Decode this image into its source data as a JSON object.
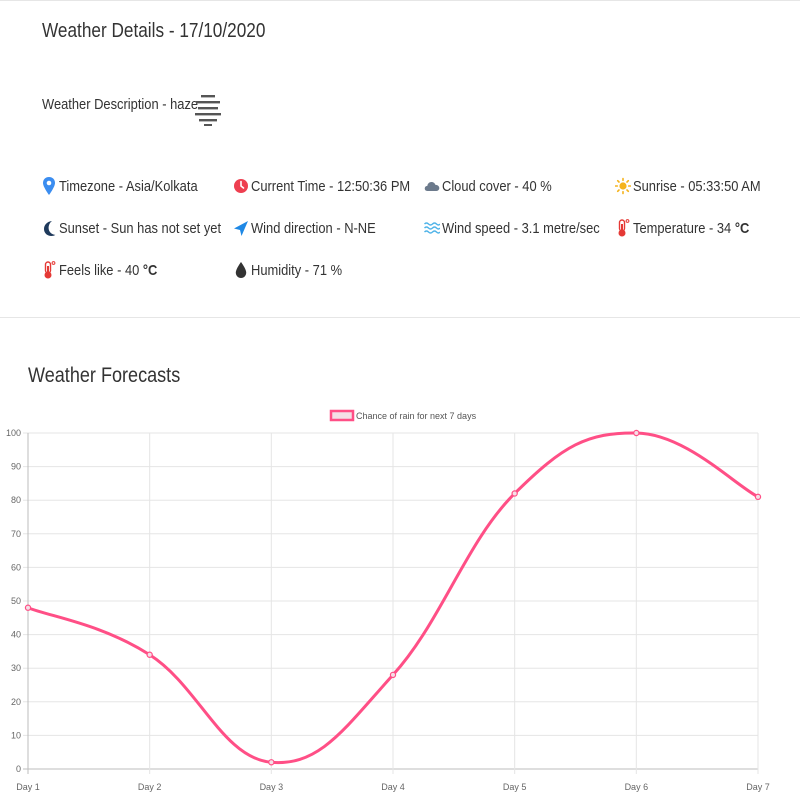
{
  "details": {
    "title": "Weather Details - 17/10/2020",
    "description_label": "Weather Description - haze",
    "description_icon": "haze-icon",
    "items": [
      {
        "name": "timezone",
        "icon": "map-pin-icon",
        "color": "#3b8df0",
        "text": "Timezone - Asia/Kolkata"
      },
      {
        "name": "current-time",
        "icon": "clock-icon",
        "color": "#ee3f50",
        "text": "Current Time - 12:50:36 PM"
      },
      {
        "name": "cloud-cover",
        "icon": "cloud-icon",
        "color": "#6c7a8c",
        "text": "Cloud cover - 40 %"
      },
      {
        "name": "sunrise",
        "icon": "sun-icon",
        "color": "#f5b31c",
        "text": "Sunrise - 05:33:50 AM"
      },
      {
        "name": "sunset",
        "icon": "moon-icon",
        "color": "#1f3a5c",
        "text": "Sunset - Sun has not set yet"
      },
      {
        "name": "wind-direction",
        "icon": "navigation-arrow-icon",
        "color": "#1e88e5",
        "text": "Wind direction - N-NE"
      },
      {
        "name": "wind-speed",
        "icon": "waves-icon",
        "color": "#4fb3e8",
        "text": "Wind speed - 3.1 metre/sec"
      },
      {
        "name": "temperature",
        "icon": "thermometer-icon",
        "color": "#e53935",
        "text": "Temperature - 34 ",
        "unit": "°C"
      },
      {
        "name": "feels-like",
        "icon": "thermometer-icon",
        "color": "#e53935",
        "text": "Feels like - 40 ",
        "unit": "°C"
      },
      {
        "name": "humidity",
        "icon": "droplet-icon",
        "color": "#333333",
        "text": "Humidity - 71 %"
      }
    ]
  },
  "forecast": {
    "title": "Weather Forecasts"
  },
  "chart_data": {
    "type": "line",
    "categories": [
      "Day 1",
      "Day 2",
      "Day 3",
      "Day 4",
      "Day 5",
      "Day 6",
      "Day 7"
    ],
    "series": [
      {
        "name": "Chance of rain for next 7 days",
        "values": [
          48,
          34,
          2,
          28,
          82,
          100,
          81
        ],
        "color": "#ff4f86",
        "fill": "#f4dfe6"
      }
    ],
    "yticks": [
      "0",
      "10",
      "20",
      "30",
      "40",
      "50",
      "60",
      "70",
      "80",
      "90",
      "100"
    ],
    "ylim": [
      0,
      100
    ],
    "grid": true,
    "smooth": true,
    "legend_position": "top"
  }
}
